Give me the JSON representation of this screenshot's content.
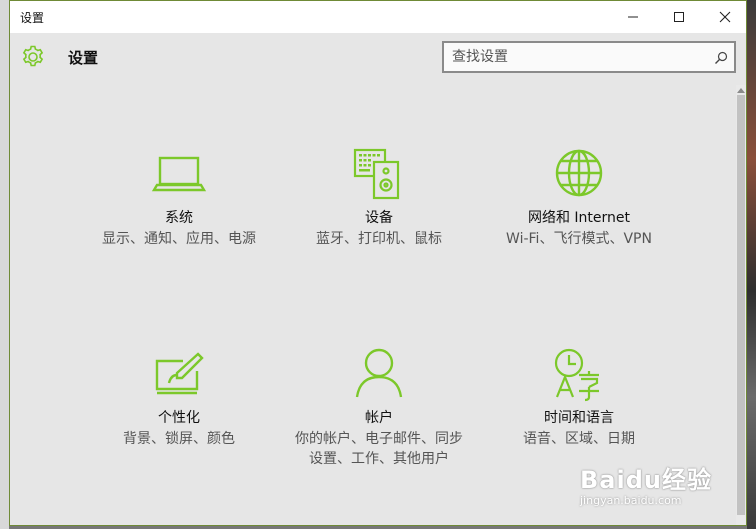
{
  "window": {
    "title": "设置"
  },
  "header": {
    "title": "设置",
    "search_placeholder": "查找设置"
  },
  "accent_color": "#7cc82a",
  "tiles": [
    {
      "icon": "laptop-icon",
      "title": "系统",
      "desc": "显示、通知、应用、电源"
    },
    {
      "icon": "devices-icon",
      "title": "设备",
      "desc": "蓝牙、打印机、鼠标"
    },
    {
      "icon": "globe-icon",
      "title": "网络和 Internet",
      "desc": "Wi-Fi、飞行模式、VPN"
    },
    {
      "icon": "personalization-icon",
      "title": "个性化",
      "desc": "背景、锁屏、颜色"
    },
    {
      "icon": "user-icon",
      "title": "帐户",
      "desc": "你的帐户、电子邮件、同步设置、工作、其他用户"
    },
    {
      "icon": "time-language-icon",
      "title": "时间和语言",
      "desc": "语音、区域、日期"
    }
  ],
  "watermark": {
    "logo": "Baidu经验",
    "url": "jingyan.baidu.com"
  }
}
